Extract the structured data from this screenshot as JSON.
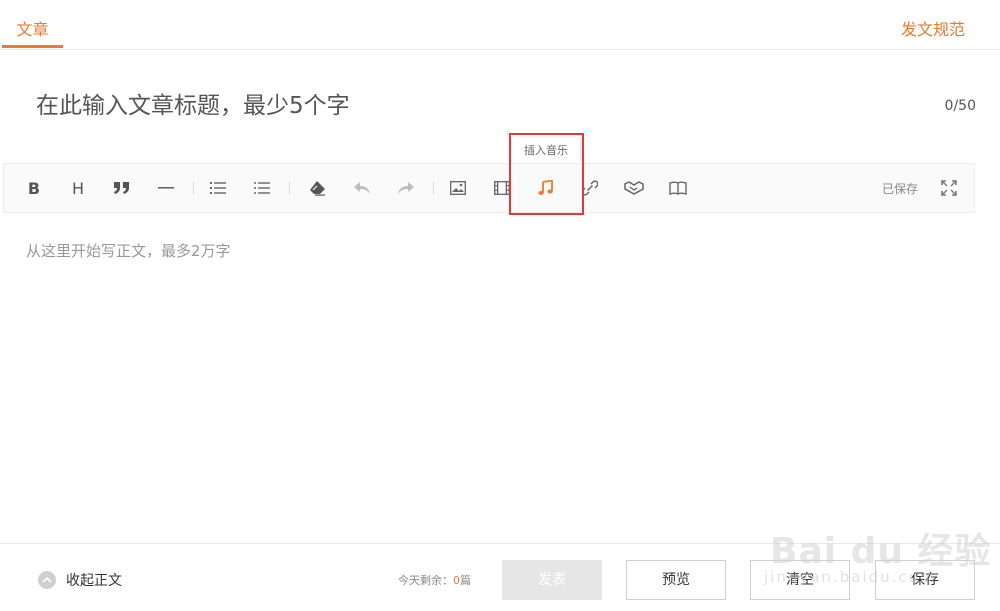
{
  "tabs": {
    "article": "文章",
    "guidelines": "发文规范"
  },
  "title": {
    "placeholder": "在此输入文章标题，最少5个字",
    "value": "",
    "count": "0/50"
  },
  "toolbar": {
    "tooltip": "插入音乐",
    "bold": "B",
    "heading": "H",
    "quote": "❞",
    "saved": "已保存",
    "icons": [
      "bold-icon",
      "heading-icon",
      "quote-icon",
      "horizontal-rule-icon",
      "ordered-list-icon",
      "unordered-list-icon",
      "eraser-icon",
      "undo-icon",
      "redo-icon",
      "image-icon",
      "video-icon",
      "music-icon",
      "link-icon",
      "handshake-icon",
      "book-icon",
      "fullscreen-icon"
    ],
    "accent": "#ee7a2b"
  },
  "content": {
    "placeholder": "从这里开始写正文，最多2万字"
  },
  "footer": {
    "collapse": "收起正文",
    "remain_prefix": "今天剩余：",
    "remain_count": "0",
    "remain_suffix": "篇",
    "publish": "发表",
    "preview": "预览",
    "clear": "清空",
    "save": "保存"
  },
  "watermark": {
    "main": "Bai du 经验",
    "sub": "jingyan.baidu.com"
  }
}
